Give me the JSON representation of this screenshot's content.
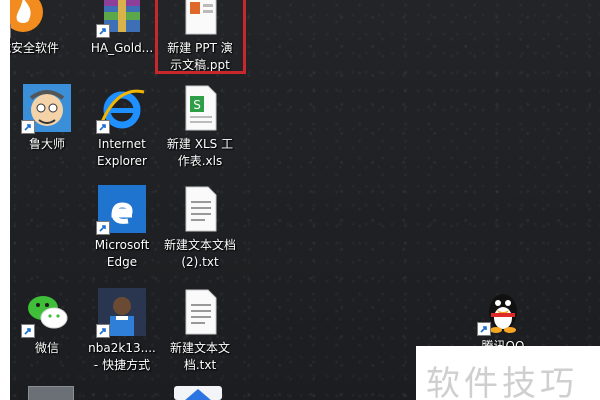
{
  "desktop": {
    "icons": [
      {
        "id": "huorong",
        "label": "火绒安全软件"
      },
      {
        "id": "ha-gold",
        "label": "HA_Gold..."
      },
      {
        "id": "new-ppt",
        "label": "新建 PPT 演\n示文稿.ppt"
      },
      {
        "id": "ludashi",
        "label": "鲁大师"
      },
      {
        "id": "ie",
        "label": "Internet\nExplorer"
      },
      {
        "id": "new-xls",
        "label": "新建 XLS 工\n作表.xls"
      },
      {
        "id": "edge",
        "label": "Microsoft\nEdge"
      },
      {
        "id": "txt2",
        "label": "新建文本文档\n(2).txt"
      },
      {
        "id": "wechat",
        "label": "微信"
      },
      {
        "id": "nba",
        "label": "nba2k13....\n- 快捷方式"
      },
      {
        "id": "txt",
        "label": "新建文本文\n档.txt"
      },
      {
        "id": "qq",
        "label": "腾讯QQ"
      }
    ]
  },
  "watermark": {
    "text": "软件技巧"
  },
  "colors": {
    "selection_border": "#c8282c",
    "background": "#1f2124",
    "label_text": "#ffffff"
  }
}
